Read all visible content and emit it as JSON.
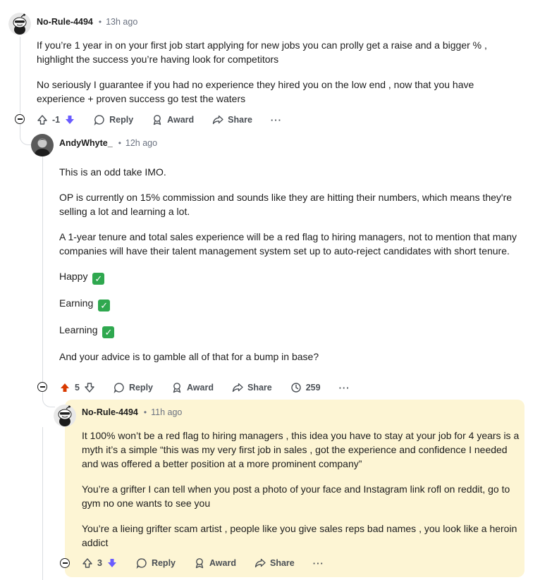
{
  "comments": [
    {
      "username": "No-Rule-4494",
      "separator": "•",
      "time": "13h ago",
      "paragraphs": [
        "If you’re 1 year in on your first job start applying for new jobs you can prolly get a raise and a bigger % , highlight the success you’re having look for competitors",
        "No seriously I guarantee if you had no experience they hired you on the low end , now that you have experience + proven success go test the waters"
      ],
      "score": "-1",
      "reply_label": "Reply",
      "award_label": "Award",
      "share_label": "Share",
      "more_label": "···"
    },
    {
      "username": "AndyWhyte_",
      "separator": "•",
      "time": "12h ago",
      "paragraphs": [
        "This is an odd take IMO.",
        "OP is currently on 15% commission and sounds like they are hitting their numbers, which means they're selling a lot and learning a lot.",
        "A 1-year tenure and total sales experience will be a red flag to hiring managers, not to mention that many companies will have their talent management system set up to auto-reject candidates with short tenure."
      ],
      "checked_items": [
        "Happy",
        "Earning",
        "Learning"
      ],
      "closing": "And your advice is to gamble all of that for a bump in base?",
      "score": "5",
      "reply_label": "Reply",
      "award_label": "Award",
      "share_label": "Share",
      "views": "259",
      "more_label": "···"
    },
    {
      "username": "No-Rule-4494",
      "separator": "•",
      "time": "11h ago",
      "paragraphs": [
        "It 100% won’t be a red flag to hiring managers , this idea you have to stay at your job for 4 years is a myth it’s a simple “this was my very first job in sales , got the experience and confidence I needed and was offered a better position at a more prominent company”",
        "You’re a grifter I can tell when you post a photo of your face and Instagram link rofl on reddit, go to gym no one wants to see you",
        "You’re a lieing grifter scam artist , people like you give sales reps bad names , you look like a heroin addict"
      ],
      "score": "3",
      "reply_label": "Reply",
      "award_label": "Award",
      "share_label": "Share",
      "more_label": "···"
    }
  ],
  "colors": {
    "downvote_active": "#6a5cff",
    "upvote_active": "#d93a00",
    "highlight_bg": "#fdf5d4",
    "check_green": "#2fa84f"
  }
}
